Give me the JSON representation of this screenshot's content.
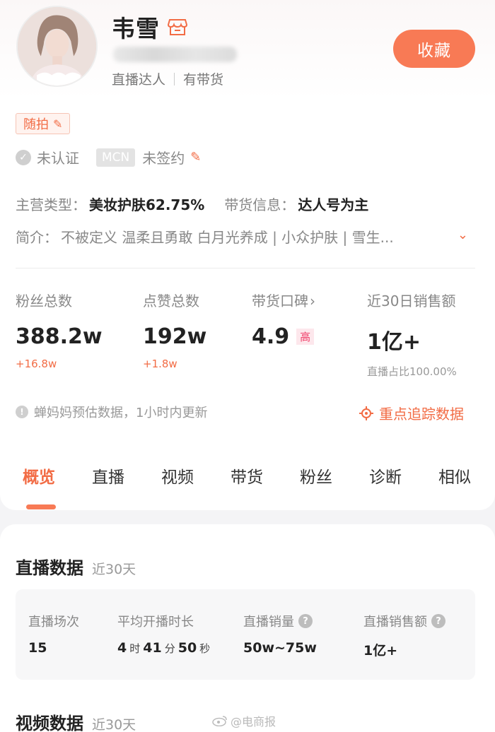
{
  "profile": {
    "name": "韦雪",
    "tags": [
      "直播达人",
      "有带货"
    ],
    "favorite_label": "收藏",
    "random_tag": "随拍",
    "cert_status": "未认证",
    "mcn_badge": "MCN",
    "mcn_status": "未签约",
    "main_type_label": "主营类型：",
    "main_type_value": "美妆护肤62.75%",
    "sales_info_label": "带货信息：",
    "sales_info_value": "达人号为主",
    "intro_label": "简介：",
    "intro_text": "不被定义 温柔且勇敢 白月光养成 | 小众护肤 | 雪生..."
  },
  "stats": [
    {
      "label": "粉丝总数",
      "value": "388.2w",
      "delta": "+16.8w"
    },
    {
      "label": "点赞总数",
      "value": "192w",
      "delta": "+1.8w"
    },
    {
      "label": "带货口碑",
      "arrow": "›",
      "value": "4.9",
      "badge": "高"
    },
    {
      "label": "近30日销售额",
      "value": "1亿+",
      "sub": "直播占比100.00%"
    }
  ],
  "notice": "蝉妈妈预估数据，1小时内更新",
  "track_link": "重点追踪数据",
  "tabs": [
    "概览",
    "直播",
    "视频",
    "带货",
    "粉丝",
    "诊断",
    "相似"
  ],
  "active_tab": 0,
  "live_section": {
    "title": "直播数据",
    "period": "近30天",
    "cols": [
      {
        "label": "直播场次",
        "value": "15"
      },
      {
        "label": "平均开播时长",
        "h": "4",
        "h_unit": "时",
        "m": "41",
        "m_unit": "分",
        "s": "50",
        "s_unit": "秒"
      },
      {
        "label": "直播销量",
        "value": "50w~75w"
      },
      {
        "label": "直播销售额",
        "value": "1亿+"
      }
    ]
  },
  "video_section": {
    "title": "视频数据",
    "period": "近30天"
  },
  "watermark": "@电商报",
  "colors": {
    "accent": "#f87a55",
    "accent_text": "#f26c45",
    "high_badge": "#f0406a"
  }
}
